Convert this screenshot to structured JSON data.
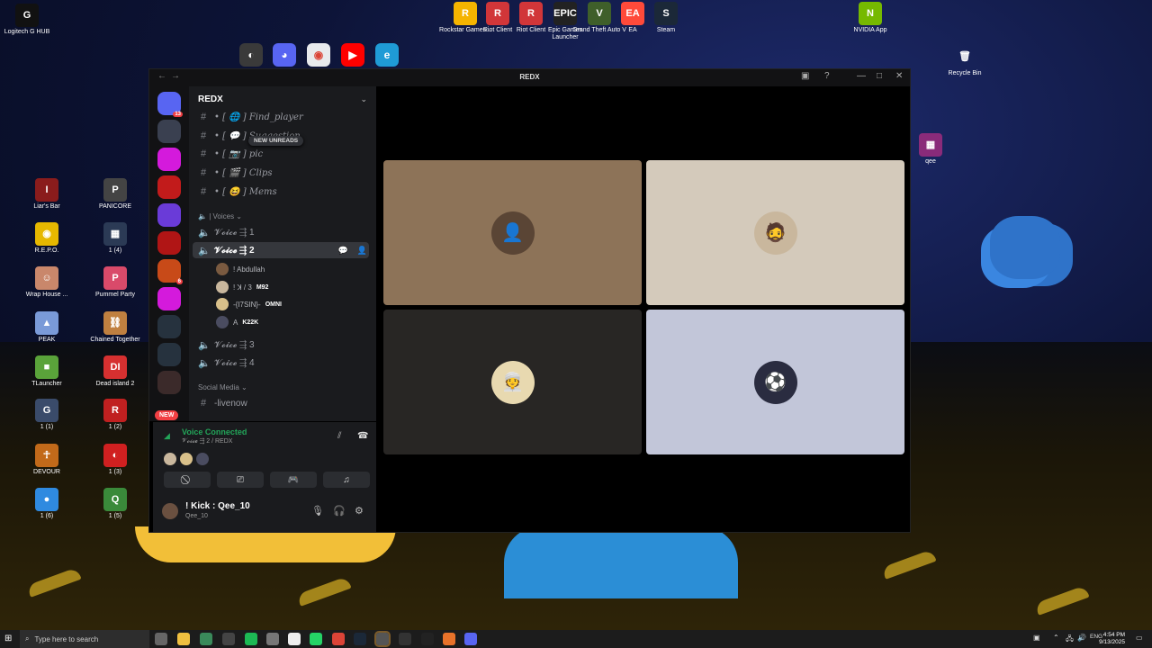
{
  "desktop": {
    "top_icons": [
      {
        "label": "Rockstar Games...",
        "icon": "rockstar-icon",
        "color": "#f5b400",
        "glyph": "R"
      },
      {
        "label": "Riot Client",
        "icon": "riot-icon",
        "color": "#d13639",
        "glyph": "R"
      },
      {
        "label": "Riot Client",
        "icon": "riot-icon",
        "color": "#d13639",
        "glyph": "R"
      },
      {
        "label": "Epic Games Launcher",
        "icon": "epic-icon",
        "color": "#222222",
        "glyph": "EPIC"
      },
      {
        "label": "Grand Theft Auto V",
        "icon": "gta-icon",
        "color": "#3f5f2a",
        "glyph": "V"
      },
      {
        "label": "EA",
        "icon": "ea-icon",
        "color": "#ff4a3a",
        "glyph": "EA"
      },
      {
        "label": "Steam",
        "icon": "steam-icon",
        "color": "#1b2838",
        "glyph": "S"
      },
      {
        "label": "NVIDIA App",
        "icon": "nvidia-icon",
        "color": "#76b900",
        "glyph": "N"
      }
    ],
    "corner_icons": [
      {
        "label": "Logitech G HUB",
        "icon": "logitech-icon",
        "glyph": "G"
      },
      {
        "label": "Recycle Bin",
        "icon": "recycle-bin-icon",
        "glyph": "🗑"
      },
      {
        "label": "qee",
        "icon": "winrar-icon",
        "glyph": "▦"
      }
    ],
    "left_col1": [
      {
        "label": "Liar's Bar",
        "color": "#8a1c1c",
        "glyph": "I"
      },
      {
        "label": "R.E.P.O.",
        "color": "#e6b800",
        "glyph": "◉"
      },
      {
        "label": "Wrap House ...",
        "color": "#c9876b",
        "glyph": "☺"
      },
      {
        "label": "PEAK",
        "color": "#7a9ad8",
        "glyph": "▲"
      },
      {
        "label": "TLauncher",
        "color": "#5aa33a",
        "glyph": "■"
      },
      {
        "label": "1 (1)",
        "color": "#3a4b6a",
        "glyph": "G"
      },
      {
        "label": "DEVOUR",
        "color": "#c26a1a",
        "glyph": "☥"
      },
      {
        "label": "1 (6)",
        "color": "#2f8ae0",
        "glyph": "●"
      }
    ],
    "left_col2": [
      {
        "label": "PANICORE",
        "color": "#444444",
        "glyph": "P"
      },
      {
        "label": "1 (4)",
        "color": "#2b3a55",
        "glyph": "▦"
      },
      {
        "label": "Pummel Party",
        "color": "#d94a6a",
        "glyph": "P"
      },
      {
        "label": "Chained Together",
        "color": "#c08040",
        "glyph": "⛓"
      },
      {
        "label": "Dead island 2",
        "color": "#d63030",
        "glyph": "DI"
      },
      {
        "label": "1 (2)",
        "color": "#c02020",
        "glyph": "R"
      },
      {
        "label": "1 (3)",
        "color": "#d02020",
        "glyph": "◐"
      },
      {
        "label": "1 (5)",
        "color": "#3a8a3a",
        "glyph": "Q"
      }
    ],
    "quick_icons": [
      "davinci-icon",
      "discord-icon",
      "chrome-icon",
      "youtube-icon",
      "edge-icon"
    ]
  },
  "window": {
    "title": "REDX",
    "back": "←",
    "fwd": "→"
  },
  "guilds": {
    "badge_dm": "13",
    "badge_g": "6",
    "new_pill": "NEW"
  },
  "server": {
    "name": "REDX",
    "new_unreads": "NEW UNREADS",
    "channels": [
      {
        "sym": "#",
        "label": "• [ 🌐 ] Find_player"
      },
      {
        "sym": "#",
        "label": "• [ 💬 ] Suggestion"
      },
      {
        "sym": "#",
        "label": "• [ 📷 ] pic"
      },
      {
        "sym": "#",
        "label": "• [ 🎬 ] Clips"
      },
      {
        "sym": "#",
        "label": "• [ 😆 ] Mems"
      }
    ],
    "voices_category": "| Voices",
    "voice_channels": [
      {
        "label": "𝓥𝓸𝓲𝓬𝓮 ⇶ 1"
      },
      {
        "label": "𝓥𝓸𝓲𝓬𝓮 ⇶ 2"
      },
      {
        "label": "𝓥𝓸𝓲𝓬𝓮 ⇶ 3"
      },
      {
        "label": "𝓥𝓸𝓲𝓬𝓮 ⇶ 4"
      }
    ],
    "voice_users": [
      {
        "name": "! Abdullah",
        "tag": ""
      },
      {
        "name": "! ꓘ / 3",
        "tag": "M92"
      },
      {
        "name": "-{I7SIN}-",
        "tag": "OMNI"
      },
      {
        "name": "A",
        "tag": "K22K"
      }
    ],
    "social_category": "Social Media",
    "social_channels": [
      {
        "label": "-livenow"
      }
    ]
  },
  "voice_panel": {
    "status": "Voice Connected",
    "location": "𝓥𝓸𝓲𝓬𝓮 ⇶ 2 / REDX"
  },
  "user": {
    "name": "! Kick : Qee_10",
    "sub": "Qee_10"
  },
  "stage": {
    "tiles": [
      {
        "color": "#8d7358",
        "avatar": "user-avatar-silhouette",
        "glyph": "👤",
        "avbg": "#5a4535"
      },
      {
        "color": "#d4cabb",
        "avatar": "user-avatar-man",
        "glyph": "🧔",
        "avbg": "#c9b79d"
      },
      {
        "color": "#282624",
        "avatar": "user-avatar-man-ghutra",
        "glyph": "👳",
        "avbg": "#e8d9b0"
      },
      {
        "color": "#c2c6d9",
        "avatar": "user-avatar-footballer",
        "glyph": "⚽",
        "avbg": "#2a2c40"
      }
    ]
  },
  "taskbar": {
    "search_placeholder": "Type here to search",
    "time": "4:54 PM",
    "date": "9/13/2025",
    "lang": "ENG"
  }
}
